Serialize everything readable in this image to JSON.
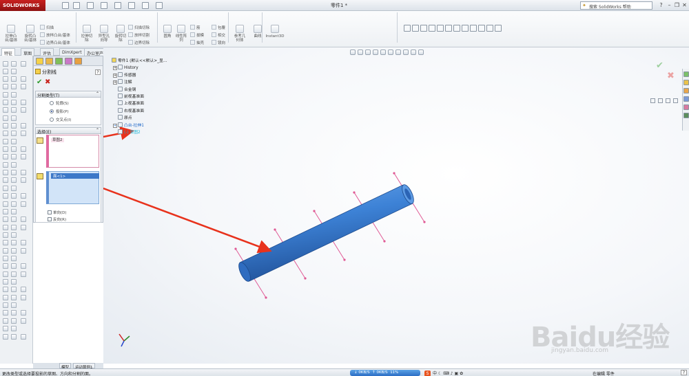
{
  "app": {
    "logo": "SOLIDWORKS",
    "doc_title": "零件1 *",
    "help_search": "搜索 SolidWorks 帮助"
  },
  "command_manager": {
    "features": [
      {
        "label": "拉伸凸\n台/基体"
      },
      {
        "label": "旋转凸\n台/基体"
      },
      {
        "label": "拉伸切\n除"
      },
      {
        "label": "异型孔\n向导"
      },
      {
        "label": "旋转切\n除"
      },
      {
        "label": "圆角"
      },
      {
        "label": "线性阵\n列"
      },
      {
        "label": "参考几\n何体"
      },
      {
        "label": "曲线"
      },
      {
        "label": "Instant3D"
      }
    ],
    "small_items": [
      "扫描",
      "放样凸台/基体",
      "边界凸台/基体",
      "扫描切除",
      "放样切割",
      "边界切除",
      "筋",
      "拔模",
      "抽壳",
      "包覆",
      "相交",
      "镜向"
    ]
  },
  "tabs": [
    "特征",
    "草图",
    "评估",
    "DimXpert",
    "办公室产品"
  ],
  "property_manager": {
    "title": "分割线",
    "help": "?",
    "ok": "✔",
    "cancel": "✖",
    "group1": {
      "header": "分割类型(T)",
      "options": [
        "轮廓(S)",
        "投影(P)",
        "交叉点(I)"
      ],
      "selected": 1
    },
    "group2": {
      "header": "选择(E)",
      "sketch_item": "草图2",
      "face_item": "面<1>",
      "check1": "单向(D)",
      "check2": "反向(R)"
    }
  },
  "tree": {
    "root": "零件1 (默认<<默认>_显...",
    "items": [
      {
        "label": "History",
        "expand": "+"
      },
      {
        "label": "传感器",
        "expand": "+"
      },
      {
        "label": "注解",
        "expand": "+"
      },
      {
        "label": "合金钢",
        "expand": ""
      },
      {
        "label": "前视基准面",
        "expand": ""
      },
      {
        "label": "上视基准面",
        "expand": ""
      },
      {
        "label": "右视基准面",
        "expand": ""
      },
      {
        "label": "原点",
        "expand": ""
      },
      {
        "label": "凸台-拉伸1",
        "expand": "+"
      },
      {
        "label": "(-) 草图2",
        "expand": ""
      }
    ]
  },
  "bottom_tabs": [
    "模型",
    "运动算例1"
  ],
  "status": {
    "text": "更改类型或选择要投影的草图、方向和分割的面。",
    "net_down": "0KB/S",
    "net_up": "0KB/S",
    "net_pct": "11%",
    "ime_label": "中",
    "mode": "在编辑 零件"
  },
  "watermark": {
    "text": "Baidu经验",
    "url": "jingyan.baidu.com"
  },
  "colors": {
    "cylinder": "#3d82d6",
    "cylinder_dark": "#1f4f96",
    "split_lines": "#e05a95",
    "arrows": "#e8321c",
    "logo_red": "#c8201f"
  }
}
